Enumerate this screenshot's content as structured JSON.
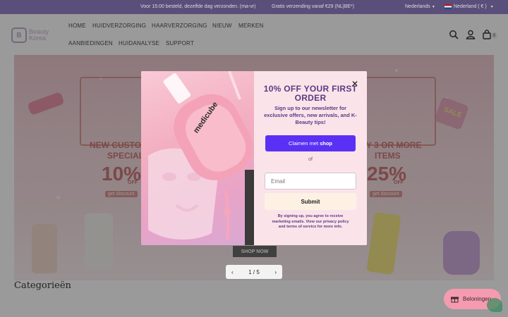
{
  "topbar": {
    "message_shipping": "Voor 15:00 besteld, dezelfde dag verzonden. (ma-vr)",
    "message_free": "Gratis verzending vanaf €29 (NL|BE*)",
    "language": "Nederlands",
    "country": "Nederland ( € )"
  },
  "header": {
    "logo_mark": "B",
    "logo_line1": "Beauty",
    "logo_line2": "Korea",
    "nav": [
      "HOME",
      "HUIDVERZORGING",
      "HAARVERZORGING",
      "NIEUW",
      "MERKEN",
      "AANBIEDINGEN",
      "HUIDANALYSE",
      "SUPPORT"
    ],
    "cart_count": "0",
    "icons": [
      "search-icon",
      "account-icon",
      "cart-icon"
    ]
  },
  "hero": {
    "left_heading": "NEW CUSTOMER SPECIAL",
    "left_heading_line1": "NEW CUSTOM",
    "left_heading_line2": "SPECIAL",
    "left_percent": "10%",
    "left_off": "OFF",
    "left_cta": "get discount",
    "right_heading_line1": "Y 3 OR MORE",
    "right_heading_line2": "ITEMS",
    "right_percent": "25%",
    "right_off": "OFF",
    "right_cta": "get discount",
    "tag": "SALE",
    "shop_now": "SHOP NOW"
  },
  "slider": {
    "prev_icon": "chevron-left-icon",
    "next_icon": "chevron-right-icon",
    "position": "1 / 5"
  },
  "section": {
    "categories_title": "Categorieën"
  },
  "popup": {
    "title": "10% OFF YOUR FIRST ORDER",
    "subtitle": "Sign up to our newsletter for exclusive offers, new arrivals, and K-Beauty tips!",
    "claim_label": "Claimen met",
    "claim_brand": "shop",
    "or_label": "of",
    "email_placeholder": "Email",
    "submit_label": "Submit",
    "legal": "By signing up, you agree to receive marketing emails. View our privacy policy and terms of service for more info.",
    "product_brand": "medicube"
  },
  "rewards": {
    "label": "Beloningen"
  },
  "colors": {
    "topbar": "#5a4f7a",
    "popup_title": "#5b3a86",
    "claim_button": "#5a31f4",
    "rewards": "#f49bb0"
  }
}
